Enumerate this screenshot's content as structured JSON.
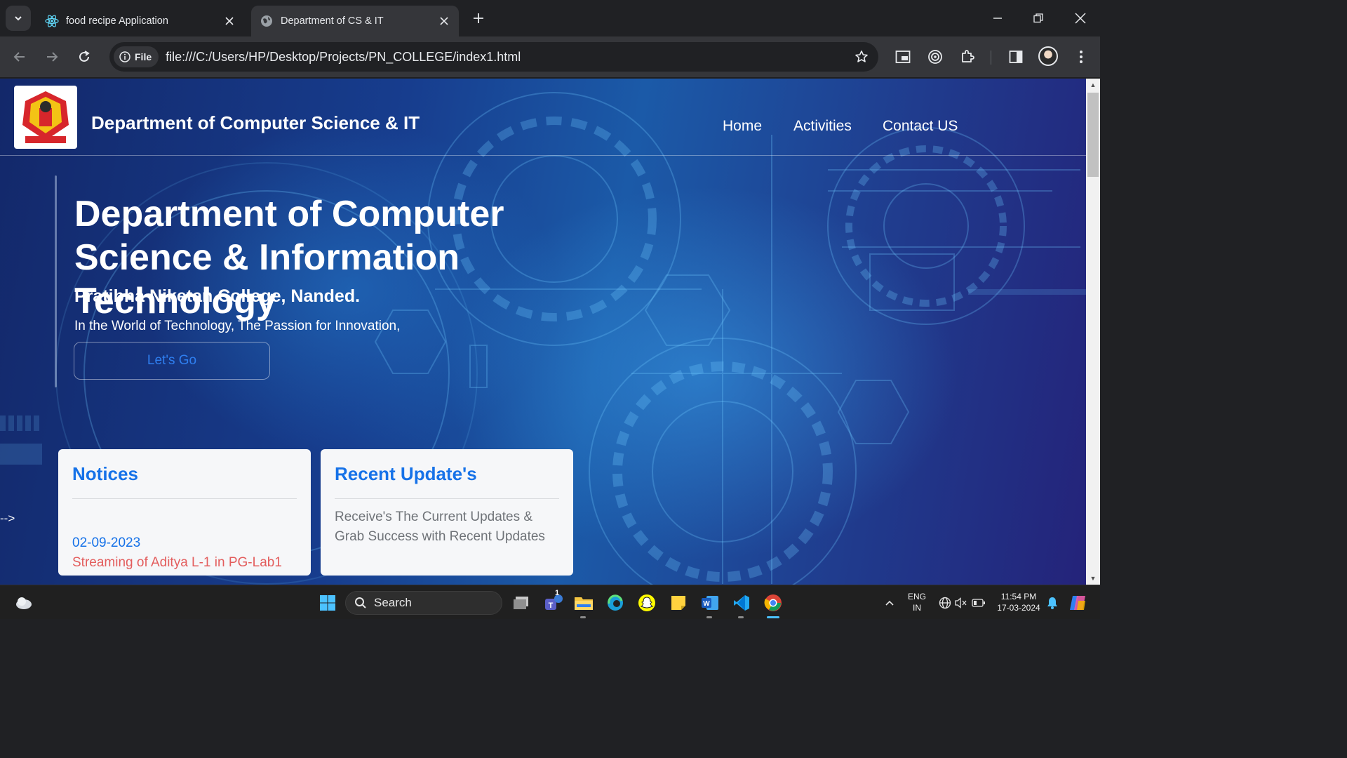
{
  "browser": {
    "tabs": [
      {
        "title": "food recipe Application",
        "active": false
      },
      {
        "title": "Department of CS & IT",
        "active": true
      }
    ],
    "url_chip": "File",
    "url": "file:///C:/Users/HP/Desktop/Projects/PN_COLLEGE/index1.html"
  },
  "site": {
    "brand": "Department of Computer Science & IT",
    "nav": [
      "Home",
      "Activities",
      "Contact US"
    ],
    "hero": {
      "title": "Department of Computer Science & Information Technology",
      "subtitle": "Pratibha Niketan College, Nanded.",
      "tagline": "In the World of Technology, The Passion for Innovation,",
      "cta": "Let's Go"
    },
    "stray_text": "-->",
    "notices": {
      "heading": "Notices",
      "date": "02-09-2023",
      "text": "Streaming of Aditya L-1 in PG-Lab1"
    },
    "updates": {
      "heading": "Recent Update's",
      "text": "Receive's The Current Updates & Grab Success with Recent Updates"
    }
  },
  "taskbar": {
    "search_label": "Search",
    "teams_badge": "1",
    "lang": "ENG",
    "region": "IN",
    "time": "11:54 PM",
    "date": "17-03-2024"
  },
  "colors": {
    "accent_blue": "#1672e8",
    "notice_red": "#e35d5d",
    "chrome_dark": "#202124",
    "chrome_toolbar": "#35363a"
  }
}
